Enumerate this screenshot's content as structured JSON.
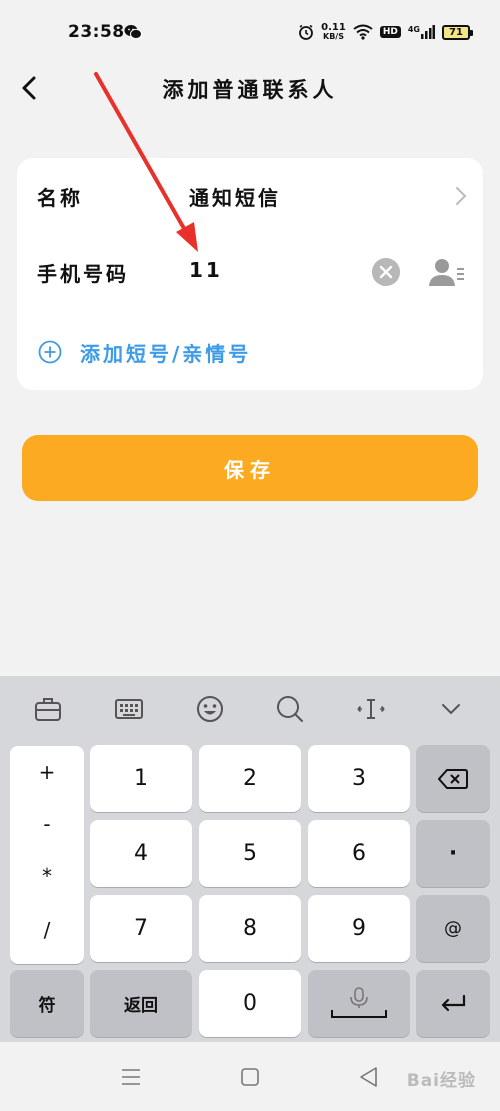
{
  "status_bar": {
    "time": "23:58",
    "net_speed_value": "0.11",
    "net_speed_unit": "KB/S",
    "hd_label": "HD",
    "signal_label": "4G",
    "battery": "71"
  },
  "header": {
    "title": "添加普通联系人"
  },
  "form": {
    "name_label": "名称",
    "name_value": "通知短信",
    "phone_label": "手机号码",
    "phone_value": "11",
    "add_short_label": "添加短号/亲情号"
  },
  "save_label": "保存",
  "keyboard": {
    "symbols": [
      "+",
      "-",
      "*",
      "/"
    ],
    "keys": {
      "k1": "1",
      "k2": "2",
      "k3": "3",
      "k4": "4",
      "k5": "5",
      "k6": "6",
      "k7": "7",
      "k8": "8",
      "k9": "9",
      "k0": "0",
      "dot": "·",
      "at": "@",
      "symbols_mode": "符",
      "back": "返回"
    },
    "toolbar_icons": [
      "briefcase-icon",
      "keyboard-icon",
      "emoji-icon",
      "search-icon",
      "cursor-icon",
      "collapse-icon"
    ]
  },
  "nav_bar": {
    "icons": [
      "menu-icon",
      "home-icon",
      "back-icon"
    ]
  },
  "watermark": "Bai经验",
  "colors": {
    "accent_orange": "#fbaa22",
    "link_blue": "#3e9be8",
    "annotation_red": "#e8312a"
  }
}
